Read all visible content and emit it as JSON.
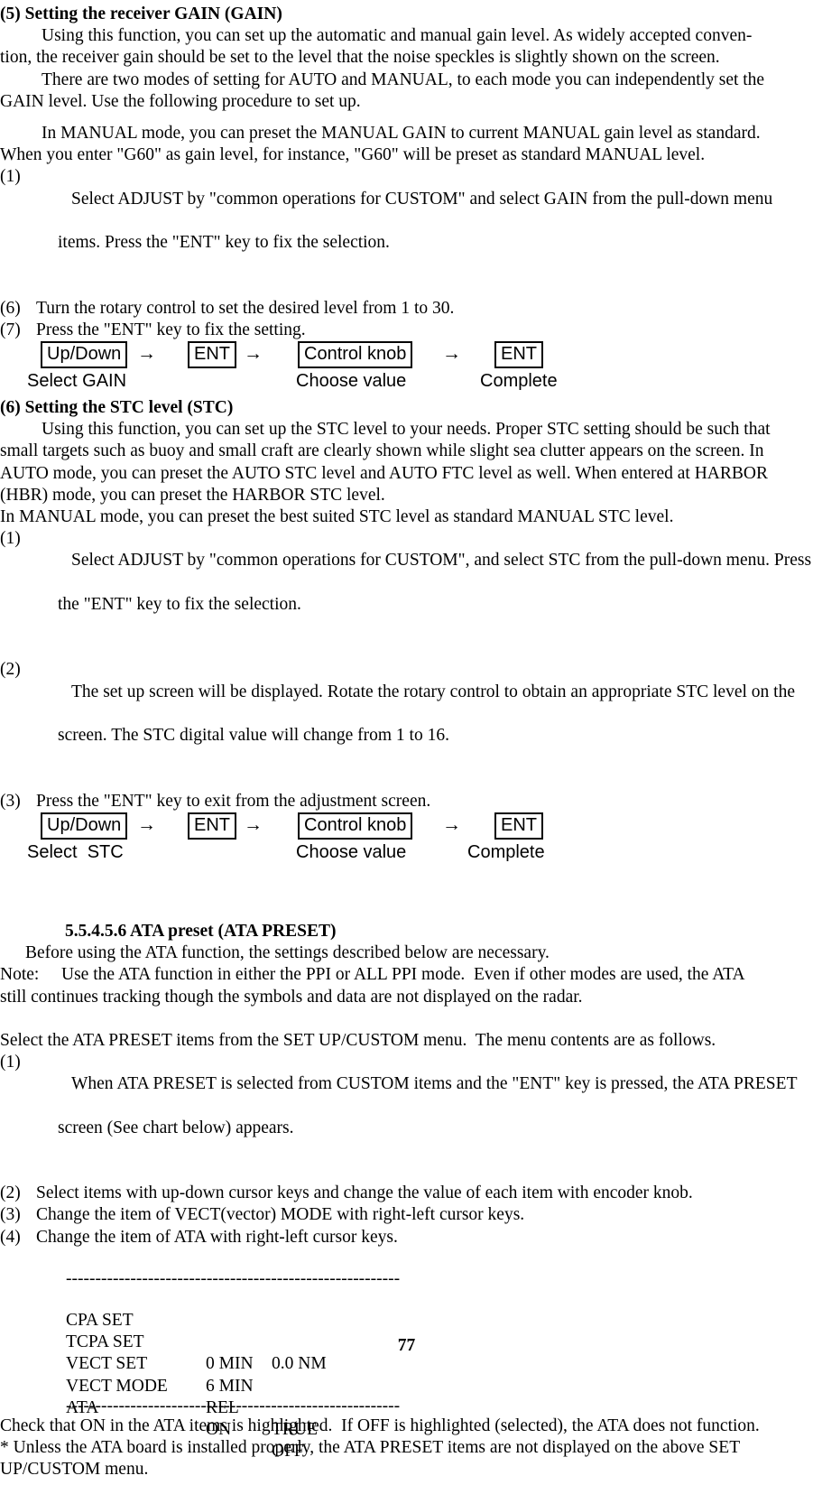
{
  "document": {
    "page_number": "77"
  },
  "section_gain": {
    "heading": "(5) Setting the receiver GAIN (GAIN)",
    "para1": "Using this function, you can set up the automatic and manual gain level. As widely accepted conven-tion, the receiver gain should be set to the level that the noise speckles is slightly shown on the screen.",
    "para1_line1": "Using this function, you can set up the automatic and manual gain level. As widely accepted conven-",
    "para1_line2": "tion, the receiver gain should be set to the level that the noise speckles is slightly shown on the screen.",
    "para2_line1": "There are two modes of setting for AUTO and MANUAL, to each mode you can independently set the",
    "para2_line2": "GAIN level. Use the following procedure to set up.",
    "para3_line1": "In MANUAL mode, you can preset the MANUAL GAIN to current MANUAL gain level as standard.",
    "para3_line2": "When you enter \"G60\" as gain level, for instance, \"G60\" will be preset as standard MANUAL level.",
    "steps": [
      {
        "num": "(1)",
        "text": "Select ADJUST by \"common operations for CUSTOM\" and select GAIN from the pull-down menu",
        "cont": "items. Press the \"ENT\" key to fix the selection."
      },
      {
        "num": "(6)",
        "text": "Turn the rotary control to set the desired level from 1 to 30.",
        "cont": ""
      },
      {
        "num": "(7)",
        "text": "Press the \"ENT\" key to fix the setting.",
        "cont": ""
      }
    ],
    "keyseq": {
      "box1": "Up/Down",
      "arrow1": "→",
      "box2": "ENT",
      "arrow2": "→",
      "box3": "Control knob",
      "arrow3": "→",
      "box4": "ENT",
      "label1": "Select GAIN",
      "label2": "Choose value",
      "label3": "Complete"
    }
  },
  "section_stc": {
    "heading": "(6) Setting the STC level (STC)",
    "para1_line1": "Using this function, you can set up the STC level to your needs. Proper STC setting should be such that",
    "para1_line2": "small targets such as buoy and small craft are clearly shown while slight sea clutter appears on the screen. In",
    "para1_line3": "AUTO mode, you can preset the AUTO STC level and AUTO FTC level as well. When entered at HARBOR",
    "para1_line4": "(HBR) mode, you can preset the HARBOR STC level.",
    "para2": "In MANUAL mode, you can preset the best suited STC level as standard MANUAL STC level.",
    "steps": [
      {
        "num": "(1)",
        "text": "Select ADJUST by \"common operations for CUSTOM\", and select STC from the pull-down menu. Press",
        "cont": "the \"ENT\" key to fix the selection."
      },
      {
        "num": "(2)",
        "text": "The set up screen will be displayed. Rotate the rotary control to obtain an appropriate STC level on the",
        "cont": "screen. The STC digital value will change from 1 to 16."
      },
      {
        "num": "(3)",
        "text": "Press the \"ENT\" key to exit from the adjustment screen.",
        "cont": ""
      }
    ],
    "keyseq": {
      "box1": "Up/Down",
      "arrow1": "→",
      "box2": "ENT",
      "arrow2": "→",
      "box3": "Control knob",
      "arrow3": "→",
      "box4": "ENT",
      "label1": "Select  STC",
      "label2": "Choose value",
      "label3": "Complete"
    }
  },
  "section_ata": {
    "heading": "5.5.4.5.6 ATA preset (ATA PRESET)",
    "intro": "Before using the ATA function, the settings described below are necessary.",
    "note_label": "Note:",
    "note_line1": "Use the ATA function in either the PPI or ALL PPI mode.  Even if other modes are used, the ATA",
    "note_line2": "still continues tracking though the symbols and data are not displayed on the radar.",
    "select_line": "Select the ATA PRESET items from the SET UP/CUSTOM menu.  The menu contents are as follows.",
    "steps": [
      {
        "num": "(1)",
        "text": "When ATA PRESET is selected from CUSTOM items and the \"ENT\" key is pressed, the ATA PRESET",
        "cont": "screen (See chart below) appears."
      },
      {
        "num": "(2)",
        "text": "Select items with up-down cursor keys and change the value of each item with encoder knob.",
        "cont": ""
      },
      {
        "num": "(3)",
        "text": "Change the item of VECT(vector) MODE with right-left cursor keys.",
        "cont": ""
      },
      {
        "num": "(4)",
        "text": "Change the item of ATA with right-left cursor keys.",
        "cont": ""
      }
    ],
    "chart": {
      "rule_top": "---------------------------------------------------------",
      "rule_bottom": "---------------------------------------------------------",
      "rows": [
        {
          "name": "CPA SET",
          "col2": "",
          "col3": "0.0 NM"
        },
        {
          "name": "TCPA SET",
          "col2": "0 MIN",
          "col3": ""
        },
        {
          "name": "VECT SET",
          "col2": "6 MIN",
          "col3": ""
        },
        {
          "name": "VECT MODE",
          "col2": "REL",
          "col3": "TRUE"
        },
        {
          "name": "ATA",
          "col2": "ON",
          "col3": "OFF"
        }
      ]
    },
    "footer_line1": "Check that ON in the ATA items is highlighted.  If OFF is highlighted (selected), the ATA does not function.",
    "footer_line2": "* Unless the ATA board is installed properly, the ATA PRESET items are not displayed on the above SET",
    "footer_line3": "UP/CUSTOM menu."
  }
}
